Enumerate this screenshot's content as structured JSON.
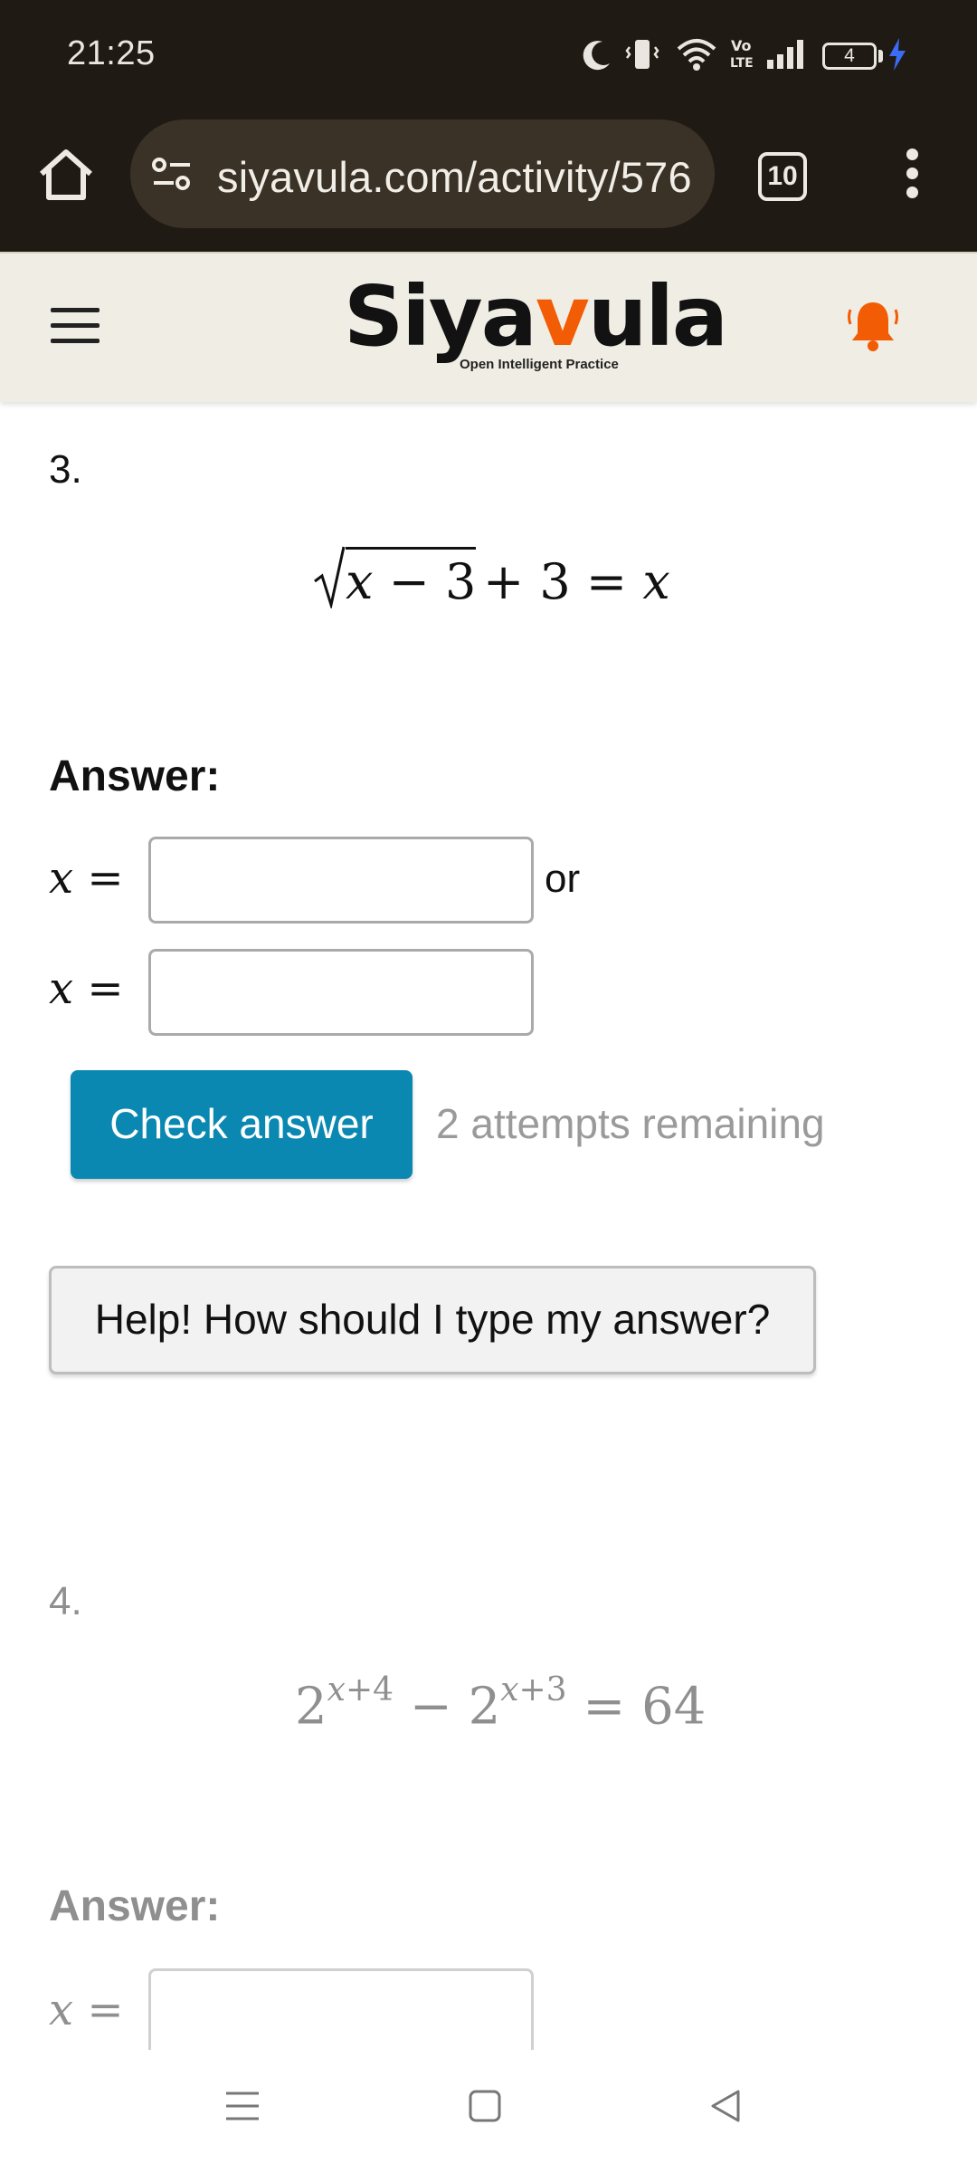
{
  "status_bar": {
    "time": "21:25",
    "battery_level": "4",
    "icons": [
      "moon-icon",
      "vibrate-icon",
      "wifi-icon",
      "volte-icon",
      "signal-icon",
      "battery-icon",
      "charging-icon"
    ]
  },
  "browser": {
    "url": "siyavula.com/activity/576",
    "tab_count": "10",
    "icons": [
      "home-icon",
      "site-settings-icon",
      "tabs-icon",
      "overflow-menu-icon"
    ]
  },
  "site": {
    "logo_text_pre": "Siya",
    "logo_text_v": "v",
    "logo_text_post": "ula",
    "tagline": "Open Intelligent Practice",
    "accent_color": "#f25c05"
  },
  "question3": {
    "number": "3.",
    "equation": {
      "radicand_x": "x",
      "radicand_rest": " − 3",
      "rhs_const": " + 3 = ",
      "rhs_var": "x"
    },
    "answer_label": "Answer:",
    "var_label": "x",
    "eq_sign": " =",
    "or_text": "or",
    "input1_value": "",
    "input2_value": "",
    "check_button": "Check answer",
    "attempts_text": "2 attempts remaining",
    "help_button": "Help! How should I type my answer?",
    "button_color": "#0a88b2"
  },
  "question4": {
    "number": "4.",
    "equation": {
      "base1": "2",
      "exp1_var": "x",
      "exp1_rest": "+4",
      "minus": " − ",
      "base2": "2",
      "exp2_var": "x",
      "exp2_rest": "+3",
      "rhs": " = 64"
    },
    "answer_label": "Answer:",
    "var_label": "x",
    "eq_sign": " =",
    "input1_value": ""
  },
  "nav_bar": {
    "icons": [
      "recent-apps-icon",
      "home-nav-icon",
      "back-icon"
    ]
  }
}
